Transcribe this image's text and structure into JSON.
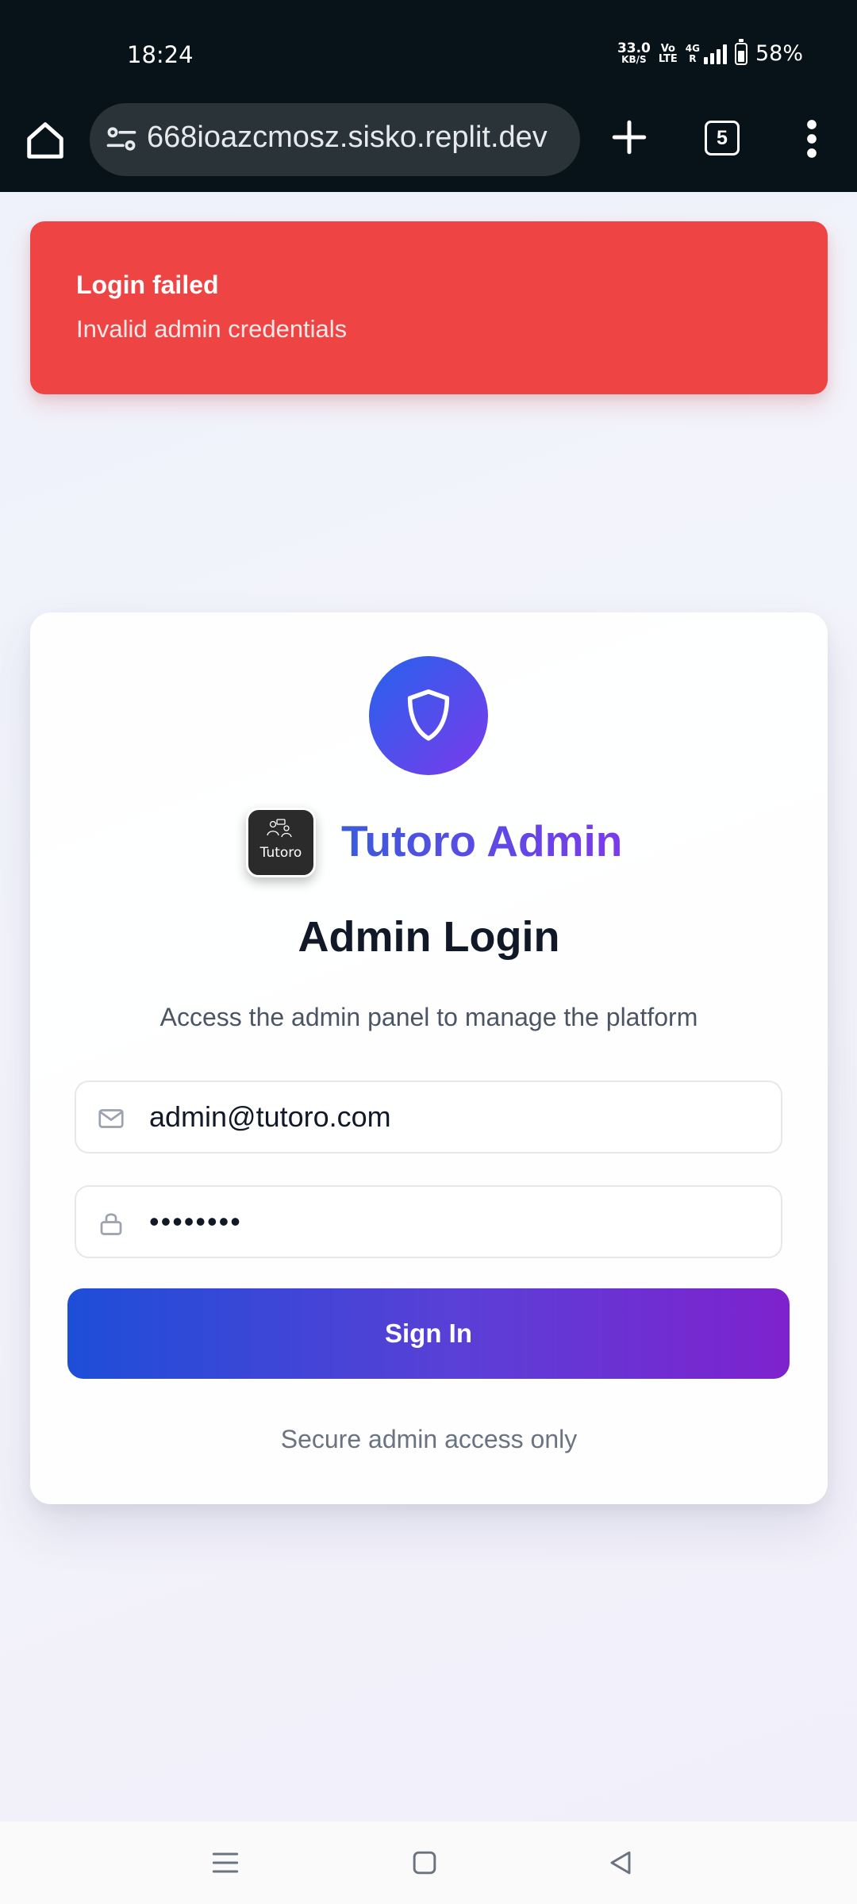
{
  "status_bar": {
    "time": "18:24",
    "net_speed_value": "33.0",
    "net_speed_unit": "KB/S",
    "volte_top": "Vo",
    "volte_bottom": "LTE",
    "signal_top": "4G",
    "signal_bottom": "R",
    "battery": "58%"
  },
  "browser": {
    "url": "668ioazcmosz.sisko.replit.dev",
    "tab_count": "5"
  },
  "toast": {
    "title": "Login failed",
    "description": "Invalid admin credentials",
    "color": "#ef4444"
  },
  "login": {
    "logo_text": "Tutoro",
    "brand_name": "Tutoro Admin",
    "title": "Admin Login",
    "subtitle": "Access the admin panel to manage the platform",
    "email_value": "admin@tutoro.com",
    "password_value": "••••••••",
    "sign_in_label": "Sign In",
    "secure_note": "Secure admin access only",
    "accent_start": "#2563eb",
    "accent_end": "#7c3aed"
  }
}
